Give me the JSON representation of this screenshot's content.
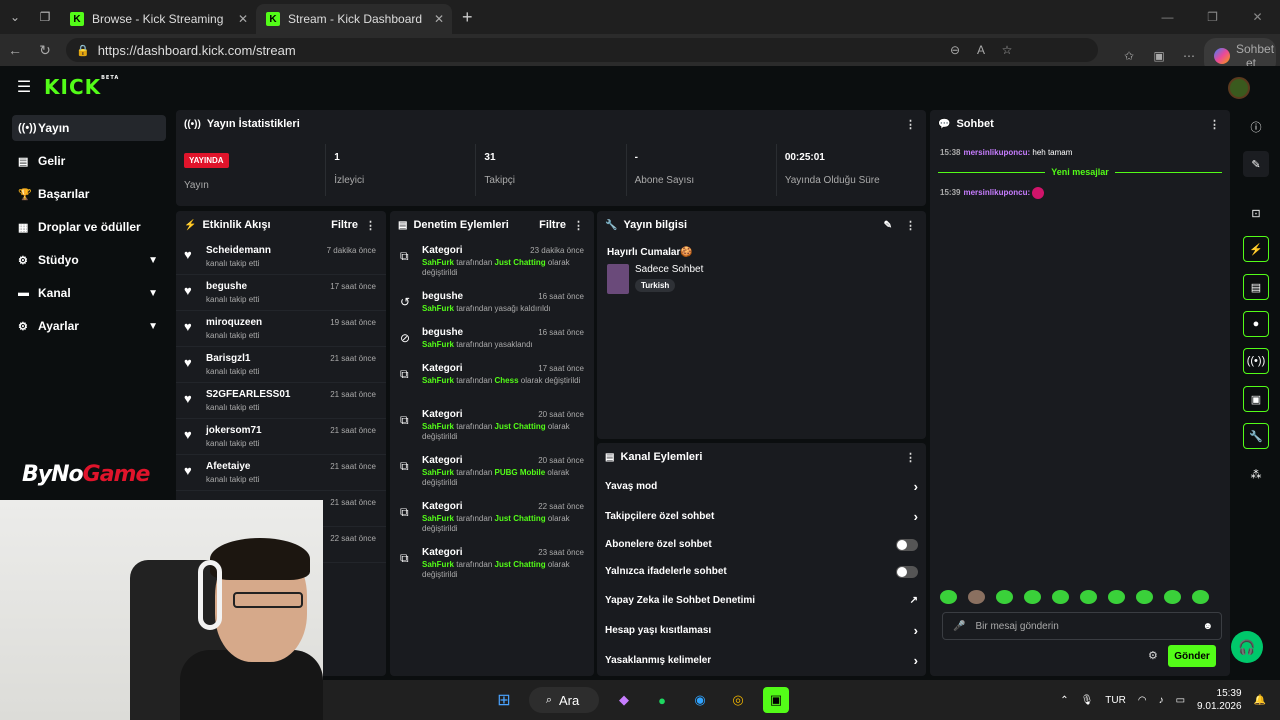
{
  "browser": {
    "tabs": [
      {
        "title": "Browse - Kick Streaming"
      },
      {
        "title": "Stream - Kick Dashboard"
      }
    ],
    "url": "https://dashboard.kick.com/stream",
    "copilot_label": "Sohbet et"
  },
  "header": {
    "logo": "KICK",
    "logo_badge": "BETA"
  },
  "sidebar": {
    "items": [
      {
        "label": "Yayın",
        "icon": "broadcast-icon"
      },
      {
        "label": "Gelir",
        "icon": "wallet-icon"
      },
      {
        "label": "Başarılar",
        "icon": "trophy-icon"
      },
      {
        "label": "Droplar ve ödüller",
        "icon": "gift-icon"
      },
      {
        "label": "Stüdyo",
        "icon": "gear-icon"
      },
      {
        "label": "Kanal",
        "icon": "channel-icon"
      },
      {
        "label": "Ayarlar",
        "icon": "settings-icon"
      }
    ]
  },
  "stats": {
    "title": "Yayın İstatistikleri",
    "items": [
      {
        "value": "YAYINDA",
        "label": "Yayın"
      },
      {
        "value": "1",
        "label": "İzleyici"
      },
      {
        "value": "31",
        "label": "Takipçi"
      },
      {
        "value": "-",
        "label": "Abone Sayısı"
      },
      {
        "value": "00:25:01",
        "label": "Yayında Olduğu Süre"
      }
    ]
  },
  "activity": {
    "title": "Etkinlik Akışı",
    "filter": "Filtre",
    "items": [
      {
        "name": "Scheidemann",
        "sub": "kanalı takip etti",
        "time": "7 dakika önce"
      },
      {
        "name": "begushe",
        "sub": "kanalı takip etti",
        "time": "17 saat önce"
      },
      {
        "name": "miroquzeen",
        "sub": "kanalı takip etti",
        "time": "19 saat önce"
      },
      {
        "name": "Barisgzl1",
        "sub": "kanalı takip etti",
        "time": "21 saat önce"
      },
      {
        "name": "S2GFEARLESS01",
        "sub": "kanalı takip etti",
        "time": "21 saat önce"
      },
      {
        "name": "jokersom71",
        "sub": "kanalı takip etti",
        "time": "21 saat önce"
      },
      {
        "name": "Afeetaiye",
        "sub": "kanalı takip etti",
        "time": "21 saat önce"
      }
    ],
    "extra_times": [
      "21 saat önce",
      "22 saat önce"
    ]
  },
  "moderation": {
    "title": "Denetim Eylemleri",
    "filter": "Filtre",
    "items": [
      {
        "name": "Kategori",
        "user": "SahFurk",
        "mid": "tarafından",
        "target": "Just Chatting",
        "rest": "olarak değiştirildi",
        "time": "23 dakika önce"
      },
      {
        "name": "begushe",
        "user": "SahFurk",
        "mid": "tarafından yasağı kaldırıldı",
        "target": "",
        "rest": "",
        "time": "16 saat önce"
      },
      {
        "name": "begushe",
        "user": "SahFurk",
        "mid": "tarafından yasaklandı",
        "target": "",
        "rest": "",
        "time": "16 saat önce"
      },
      {
        "name": "Kategori",
        "user": "SahFurk",
        "mid": "tarafından",
        "target": "Chess",
        "rest": "olarak değiştirildi",
        "time": "17 saat önce"
      },
      {
        "name": "Kategori",
        "user": "SahFurk",
        "mid": "tarafından",
        "target": "Just Chatting",
        "rest": "olarak değiştirildi",
        "time": "20 saat önce"
      },
      {
        "name": "Kategori",
        "user": "SahFurk",
        "mid": "tarafından",
        "target": "PUBG Mobile",
        "rest": "olarak değiştirildi",
        "time": "20 saat önce"
      },
      {
        "name": "Kategori",
        "user": "SahFurk",
        "mid": "tarafından",
        "target": "Just Chatting",
        "rest": "olarak değiştirildi",
        "time": "22 saat önce"
      },
      {
        "name": "Kategori",
        "user": "SahFurk",
        "mid": "tarafından",
        "target": "Just Chatting",
        "rest": "olarak değiştirildi",
        "time": "23 saat önce"
      }
    ]
  },
  "stream_info": {
    "title": "Yayın bilgisi",
    "stream_title": "Hayırlı Cumalar🍪",
    "category": "Sadece Sohbet",
    "tag": "Turkish"
  },
  "channel_actions": {
    "title": "Kanal Eylemleri",
    "items": [
      {
        "label": "Yavaş mod",
        "type": "arrow"
      },
      {
        "label": "Takipçilere özel sohbet",
        "type": "arrow"
      },
      {
        "label": "Abonelere özel sohbet",
        "type": "toggle"
      },
      {
        "label": "Yalnızca ifadelerle sohbet",
        "type": "toggle"
      },
      {
        "label": "Yapay Zeka ile Sohbet Denetimi",
        "type": "external"
      },
      {
        "label": "Hesap yaşı kısıtlaması",
        "type": "arrow"
      },
      {
        "label": "Yasaklanmış kelimeler",
        "type": "arrow"
      }
    ]
  },
  "chat": {
    "title": "Sohbet",
    "messages": [
      {
        "time": "15:38",
        "user": "mersinlikuponcu:",
        "text": "heh tamam"
      },
      {
        "time": "15:39",
        "user": "mersinlikuponcu:",
        "text": ""
      }
    ],
    "new_messages": "Yeni mesajlar",
    "placeholder": "Bir mesaj gönderin",
    "send": "Gönder"
  },
  "overlay": {
    "brand_a": "ByNo",
    "brand_b": "Game"
  },
  "taskbar": {
    "search": "Ara",
    "lang": "TUR",
    "time": "15:39",
    "date": "9.01.2026"
  },
  "colors": {
    "accent": "#53fc18",
    "live": "#e0142b",
    "panel": "#191b1f",
    "bg": "#0b0e0f"
  }
}
